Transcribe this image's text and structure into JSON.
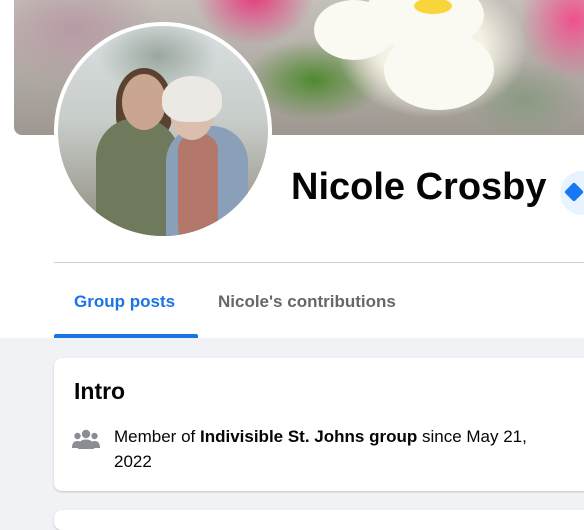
{
  "profile": {
    "name": "Nicole Crosby"
  },
  "tabs": [
    {
      "label": "Group posts",
      "active": true
    },
    {
      "label": "Nicole's contributions",
      "active": false
    }
  ],
  "intro": {
    "title": "Intro",
    "prefix": "Member of ",
    "group": "Indivisible St. Johns group",
    "suffix": " since May 21, 2022",
    "icon": "group-members-icon"
  },
  "colors": {
    "accent": "#1b74e4",
    "background": "#f0f2f5",
    "text": "#050505",
    "muted": "#65676b"
  }
}
